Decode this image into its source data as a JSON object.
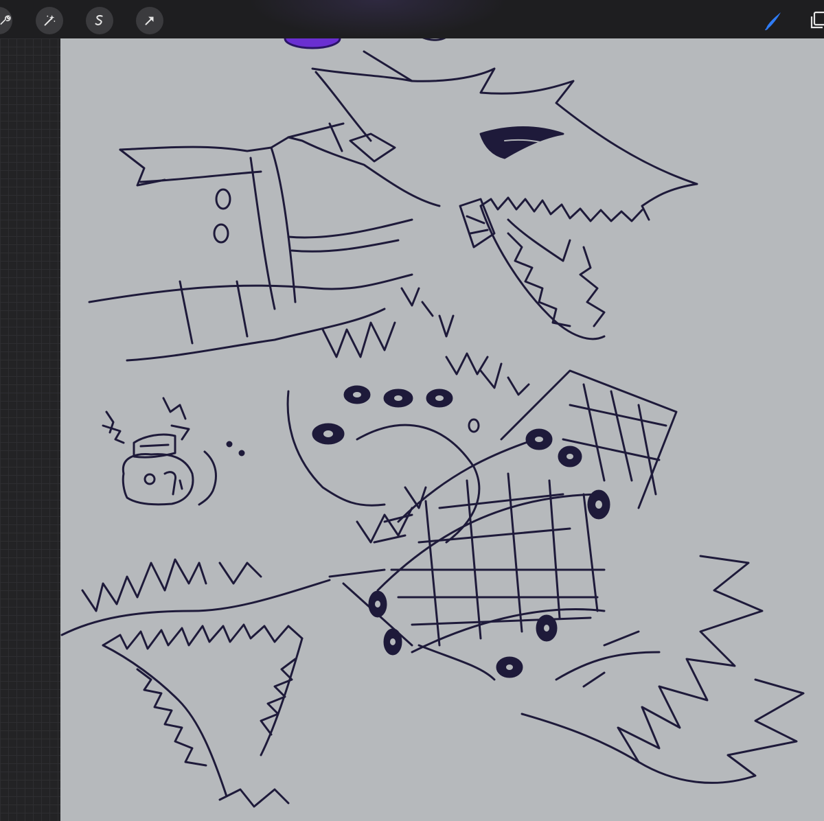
{
  "toolbar": {
    "left_tools": [
      {
        "name": "wrench-icon"
      },
      {
        "name": "magic-wand-icon"
      },
      {
        "name": "selection-icon"
      },
      {
        "name": "transform-arrow-icon"
      }
    ],
    "right_tools": [
      {
        "name": "brush-icon",
        "active": true
      },
      {
        "name": "layers-icon"
      }
    ]
  },
  "colors": {
    "toolbar_bg": "#1e1e20",
    "canvas_bg": "#b6b9bc",
    "ink": "#1e1a3a",
    "accent_blue": "#2f7cf6",
    "purple_mark": "#6a2fd1"
  }
}
